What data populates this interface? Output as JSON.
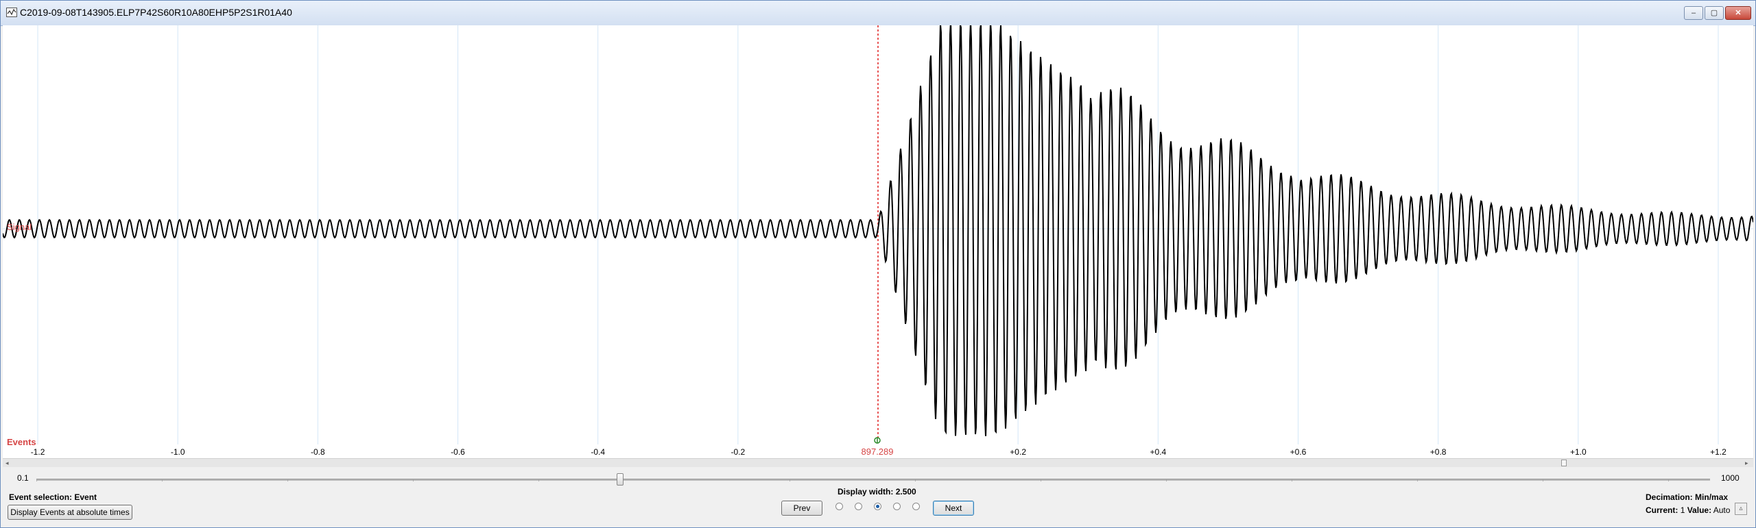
{
  "window": {
    "title": "C2019-09-08T143905.ELP7P42S60R10A80EHP5P2S1R01A40",
    "controls": {
      "minimize": "–",
      "maximize": "▢",
      "close": "✕"
    }
  },
  "plot": {
    "signal_label": "Signal",
    "events_label": "Events",
    "event_marker_label": "897.289",
    "x_tick_labels": [
      "-1.2",
      "-1.0",
      "-0.8",
      "-0.6",
      "-0.4",
      "-0.2",
      "+0.2",
      "+0.4",
      "+0.6",
      "+0.8",
      "+1.0",
      "+1.2"
    ],
    "x_ticks": [
      -1.2,
      -1.0,
      -0.8,
      -0.6,
      -0.4,
      -0.2,
      0.2,
      0.4,
      0.6,
      0.8,
      1.0,
      1.2
    ],
    "display_range": [
      -1.25,
      1.25
    ],
    "event_time": 0,
    "colors": {
      "trace": "#000000",
      "grid": "#d4e7f7",
      "event_line": "#e02020",
      "label": "#d64545",
      "marker": "#2a8a2a"
    }
  },
  "zoom": {
    "min_label": "0.1",
    "max_label": "1000"
  },
  "bottom": {
    "event_selection_label": "Event selection:",
    "event_selection_value": "Event",
    "display_events_button": "Display Events at absolute times",
    "display_width_label": "Display width:",
    "display_width_value": "2.500",
    "prev_button": "Prev",
    "next_button": "Next",
    "radio_selected_index": 2,
    "decimation_label": "Decimation:",
    "decimation_value": "Min/max",
    "current_label": "Current:",
    "current_value": "1",
    "value_label": "Value:",
    "value_value": "Auto",
    "spin_icon": "▵"
  }
}
